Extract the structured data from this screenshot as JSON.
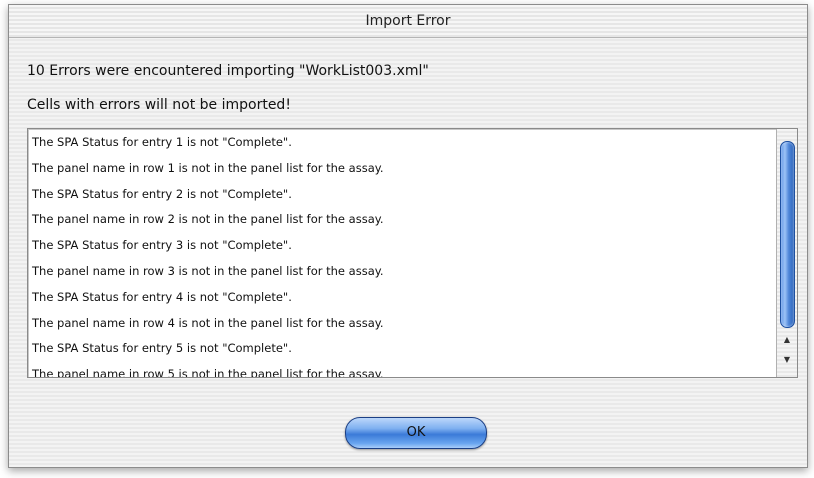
{
  "window": {
    "title": "Import Error"
  },
  "messages": {
    "summary": "10 Errors were encountered importing \"WorkList003.xml\"",
    "warning": "Cells with errors will not be imported!"
  },
  "error_list": [
    "The SPA Status for entry 1 is not \"Complete\".",
    "The panel name in row 1 is not in the panel list for the assay.",
    "The SPA Status for entry 2 is not \"Complete\".",
    "The panel name in row 2 is not in the panel list for the assay.",
    "The SPA Status for entry 3 is not \"Complete\".",
    "The panel name in row 3 is not in the panel list for the assay.",
    "The SPA Status for entry 4 is not \"Complete\".",
    "The panel name in row 4 is not in the panel list for the assay.",
    "The SPA Status for entry 5 is not \"Complete\".",
    "The panel name in row 5 is not in the panel list for the assay."
  ],
  "scrollbar": {
    "up_arrow": "▲",
    "down_arrow": "▼"
  },
  "buttons": {
    "ok_label": "OK"
  },
  "colors": {
    "button_accent": "#3b7ad8",
    "scroll_thumb": "#4f86d9"
  }
}
